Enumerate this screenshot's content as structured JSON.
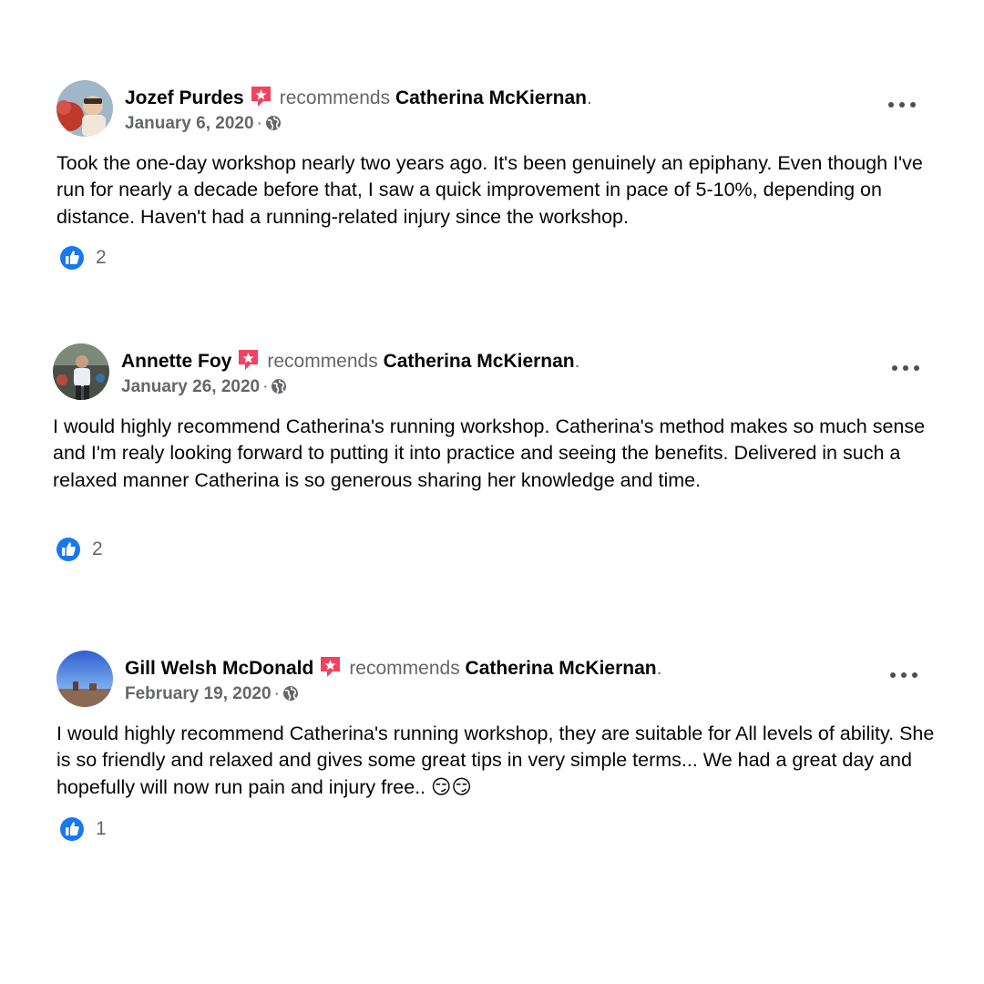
{
  "reviews": [
    {
      "author": "Jozef Purdes",
      "verb": "recommends",
      "page": "Catherina McKiernan",
      "date": "January 6, 2020",
      "text": "Took the one-day workshop nearly two years ago.  It's been genuinely an epiphany.  Even though I've run for nearly a decade before that, I saw a quick improvement in pace of 5-10%, depending on distance.  Haven't had a running-related injury since the workshop.",
      "likes": "2"
    },
    {
      "author": "Annette Foy",
      "verb": "recommends",
      "page": "Catherina McKiernan",
      "date": "January 26, 2020",
      "text": "I would highly recommend Catherina's running workshop. Catherina's method makes so much sense and I'm realy looking forward to putting it into practice and seeing the benefits. Delivered in such a relaxed manner Catherina is so generous sharing her knowledge and time.",
      "likes": "2"
    },
    {
      "author": "Gill Welsh McDonald",
      "verb": "recommends",
      "page": "Catherina McKiernan",
      "date": "February 19, 2020",
      "text": "I would highly recommend Catherina's running workshop, they are suitable for All levels of ability.  She is so friendly and relaxed and gives some great tips in very simple terms... We had a great day and hopefully will now run pain and injury free.. 😏😏",
      "likes": "1"
    }
  ],
  "punctuation": {
    "period": ".",
    "dot": "·"
  },
  "colors": {
    "like_blue": "#1877f2",
    "badge_red": "#f3425f",
    "secondary_text": "#65676b",
    "primary_text": "#050505"
  },
  "icons": {
    "badge": "recommendation-star-badge-icon",
    "privacy": "globe-icon",
    "menu": "more-options-icon",
    "reaction": "like-thumb-icon"
  }
}
